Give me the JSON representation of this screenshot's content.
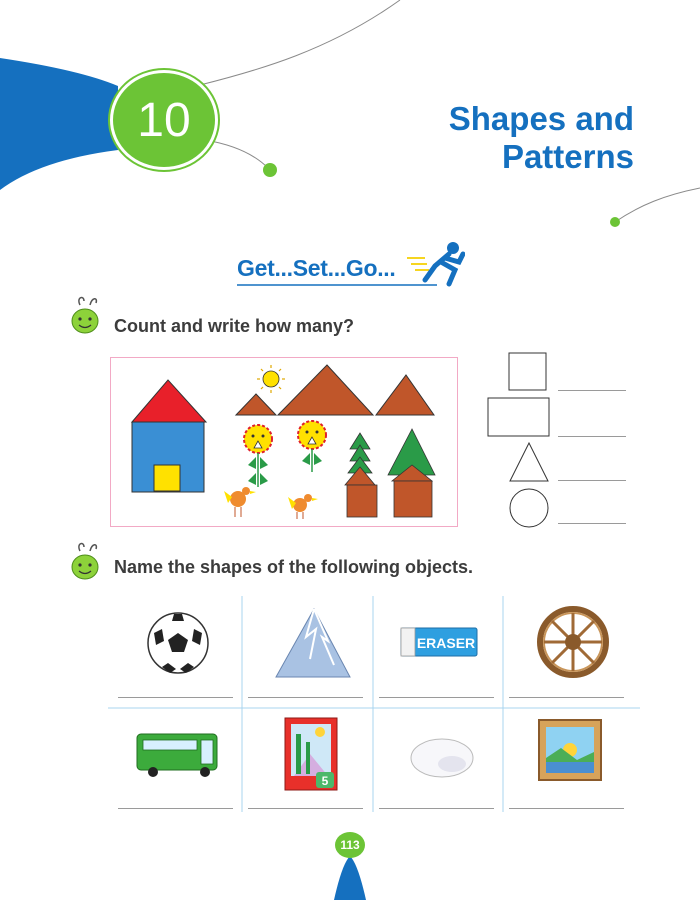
{
  "chapter": {
    "number": "10",
    "title_line1": "Shapes and",
    "title_line2": "Patterns"
  },
  "section_heading": "Get...Set...Go...",
  "exercise1": {
    "instruction": "Count and write how many?",
    "shapes_to_count": [
      "square-icon",
      "rectangle-icon",
      "triangle-icon",
      "circle-icon"
    ]
  },
  "exercise2": {
    "instruction": "Name the shapes of the following objects.",
    "objects": [
      "football-icon",
      "mountain-icon",
      "eraser-icon",
      "wheel-icon",
      "bus-icon",
      "book-icon",
      "egg-icon",
      "picture-frame-icon"
    ],
    "eraser_label": "ERASER",
    "book_number": "5"
  },
  "page_number": "113",
  "colors": {
    "brand_blue": "#1570bf",
    "brand_green": "#6cc436",
    "shape_brown": "#c0562a",
    "shape_red": "#e8202a",
    "shape_blue": "#3a8fd4",
    "shape_green": "#2a9b48",
    "shape_yellow": "#ffe100"
  }
}
